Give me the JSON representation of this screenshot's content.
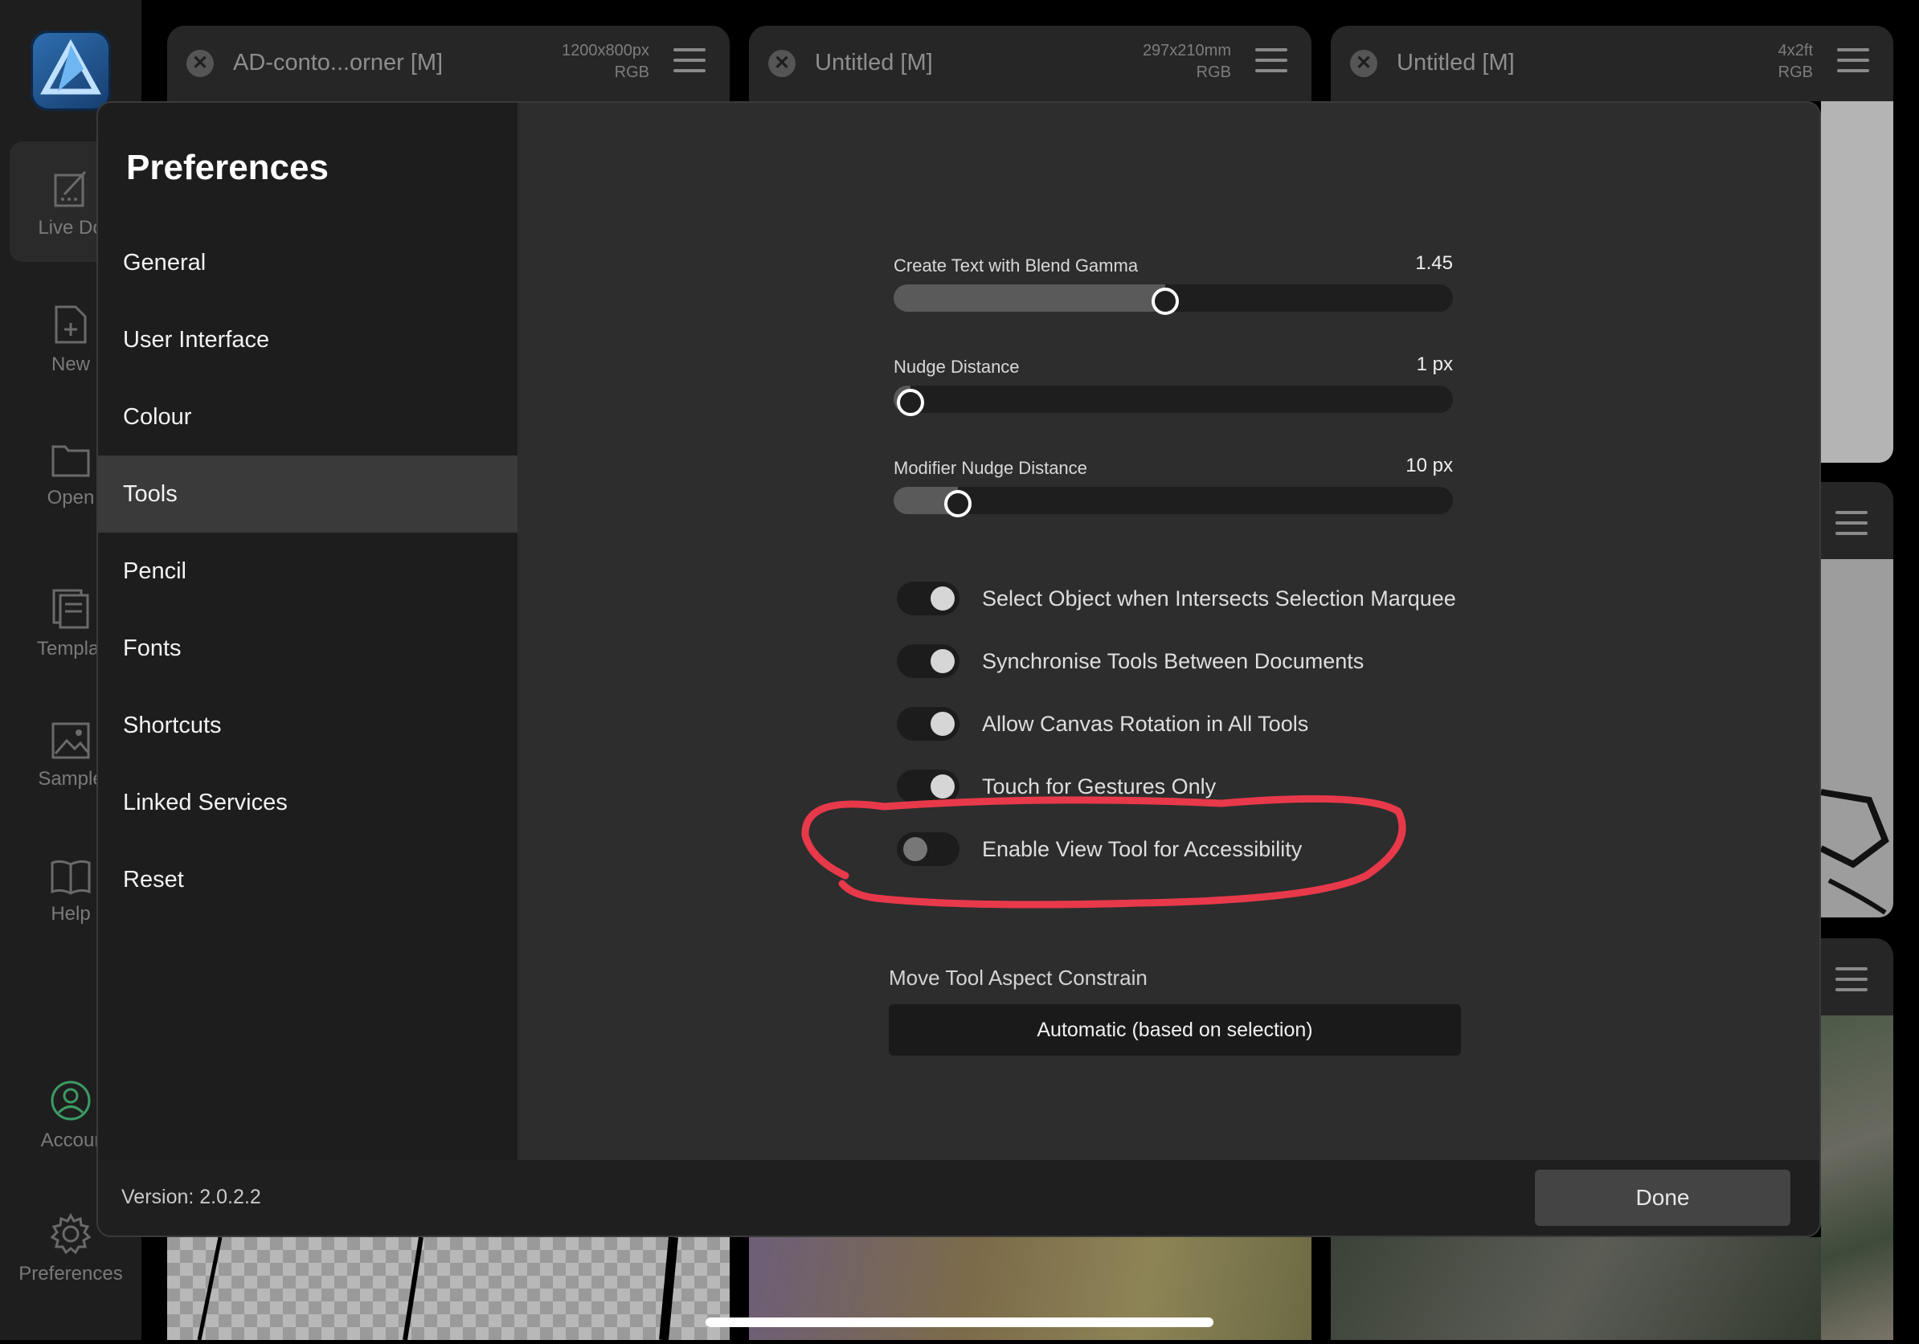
{
  "app_nav": [
    {
      "label": "Live Do",
      "icon": "live-document-icon"
    },
    {
      "label": "New",
      "icon": "new-document-icon"
    },
    {
      "label": "Open",
      "icon": "folder-icon"
    },
    {
      "label": "Templat",
      "icon": "template-icon"
    },
    {
      "label": "Sample",
      "icon": "image-icon"
    },
    {
      "label": "Help",
      "icon": "book-icon"
    },
    {
      "label": "Accour",
      "icon": "account-icon"
    },
    {
      "label": "Preferences",
      "icon": "gear-icon"
    }
  ],
  "documents": [
    {
      "title": "AD-conto...orner [M]",
      "size": "1200x800px",
      "mode": "RGB"
    },
    {
      "title": "Untitled [M]",
      "size": "297x210mm",
      "mode": "RGB"
    },
    {
      "title": "Untitled [M]",
      "size": "4x2ft",
      "mode": "RGB"
    }
  ],
  "preferences": {
    "title": "Preferences",
    "nav": [
      "General",
      "User Interface",
      "Colour",
      "Tools",
      "Pencil",
      "Fonts",
      "Shortcuts",
      "Linked Services",
      "Reset"
    ],
    "selected": "Tools",
    "sliders": [
      {
        "label": "Create Text with Blend Gamma",
        "value": "1.45",
        "fraction": 0.485
      },
      {
        "label": "Nudge Distance",
        "value": "1 px",
        "fraction": 0.03
      },
      {
        "label": "Modifier Nudge Distance",
        "value": "10 px",
        "fraction": 0.115
      }
    ],
    "toggles": [
      {
        "label": "Select Object when Intersects Selection Marquee",
        "on": true
      },
      {
        "label": "Synchronise Tools Between Documents",
        "on": true
      },
      {
        "label": "Allow Canvas Rotation in All Tools",
        "on": true
      },
      {
        "label": "Touch for Gestures Only",
        "on": true
      },
      {
        "label": "Enable View Tool for Accessibility",
        "on": false
      }
    ],
    "move_tool": {
      "label": "Move Tool Aspect Constrain",
      "value": "Automatic (based on selection)"
    },
    "version": "Version: 2.0.2.2",
    "done_label": "Done"
  },
  "annotation_color": "#e8394a"
}
